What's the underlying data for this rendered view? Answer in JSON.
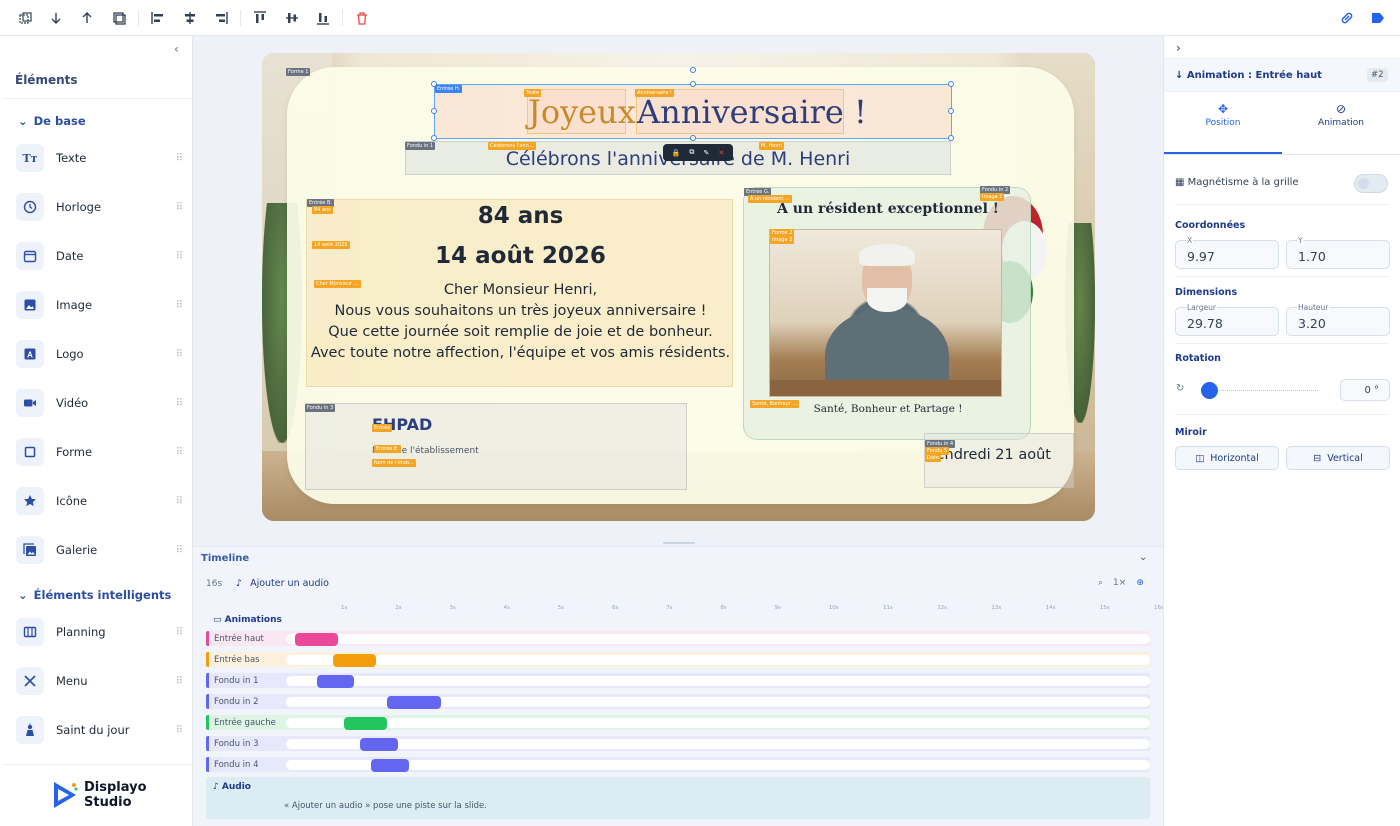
{
  "toolbar": {
    "icons": [
      "duplicate-icon",
      "arrow-down-icon",
      "arrow-up-icon",
      "copy-icon",
      "align-left-icon",
      "align-center-h-icon",
      "align-right-icon",
      "align-top-icon",
      "align-middle-v-icon",
      "align-bottom-icon",
      "delete-icon",
      "link-icon",
      "tag-icon"
    ],
    "accent": "#2563eb"
  },
  "sidebar": {
    "title": "Éléments",
    "section_basic": "De base",
    "basic_items": [
      {
        "label": "Texte",
        "icon": "text-icon"
      },
      {
        "label": "Horloge",
        "icon": "clock-icon"
      },
      {
        "label": "Date",
        "icon": "calendar-icon"
      },
      {
        "label": "Image",
        "icon": "image-icon"
      },
      {
        "label": "Logo",
        "icon": "logo-icon"
      },
      {
        "label": "Vidéo",
        "icon": "video-icon"
      },
      {
        "label": "Forme",
        "icon": "shape-icon"
      },
      {
        "label": "Icône",
        "icon": "star-icon"
      },
      {
        "label": "Galerie",
        "icon": "gallery-icon"
      }
    ],
    "section_smart": "Éléments intelligents",
    "smart_items": [
      {
        "label": "Planning",
        "icon": "planning-icon"
      },
      {
        "label": "Menu",
        "icon": "menu-icon"
      },
      {
        "label": "Saint du jour",
        "icon": "saint-icon"
      }
    ],
    "brand_line1": "Displayo",
    "brand_line2": "Studio"
  },
  "canvas": {
    "title_word1": "Joyeux",
    "title_word2": "Anniversaire !",
    "subtitle": "Célébrons l'anniversaire de M. Henri",
    "age": "84 ans",
    "birth_date": "14 août 2026",
    "message": "Cher Monsieur Henri,\nNous vous souhaitons un très joyeux anniversaire !\nQue cette journée soit remplie de joie et de bonheur.\nAvec toute notre affection, l'équipe et vos amis résidents.",
    "resident_title": "À un résident exceptionnel !",
    "resident_caption": "Santé, Bonheur et Partage !",
    "establishment": "EHPAD",
    "establishment_sub": "Nom de l'établissement",
    "date": "vendredi 21 août",
    "tags": {
      "forme1": "Forme 1",
      "entree_h": "Entrée H.",
      "texte": "Texte",
      "anniversaire": "Anniversaire !",
      "fondu1": "Fondu in 1",
      "celebrons": "Célébrons l'ann...",
      "mhenri": "M. Henri",
      "entree_b": "Entrée B.",
      "ans84": "84 ans",
      "aout": "14 août 2026",
      "cher": "Cher Monsieur ...",
      "entree_g": "Entrée G.",
      "resident": "À un résident ...",
      "fondu2": "Fondu in 2",
      "image1": "Image 1",
      "forme2": "Forme 2",
      "image2": "Image 2",
      "sante": "Santé, Bonheur ...",
      "fondu3": "Fondu in 3",
      "entree": "Entrée",
      "ehpad": "Entrée E.",
      "nometab": "Nom de l'étab...",
      "fondu4": "Fondu in 4",
      "fondu5": "Fondu 5",
      "date": "Date"
    }
  },
  "timeline": {
    "title": "Timeline",
    "duration": "16s",
    "add_audio": "Ajouter un audio",
    "zoom": "1×",
    "animations_label": "Animations",
    "ticks": [
      "1s",
      "2s",
      "3s",
      "4s",
      "5s",
      "6s",
      "7s",
      "8s",
      "9s",
      "10s",
      "11s",
      "12s",
      "13s",
      "14s",
      "15s",
      "16s"
    ],
    "tracks": [
      {
        "name": "Entrée haut",
        "color": "#ec4899",
        "start": 0.2,
        "end": 1.0,
        "bg": "#fbe7f1"
      },
      {
        "name": "Entrée bas",
        "color": "#f59e0b",
        "start": 0.9,
        "end": 1.7,
        "bg": "#fdf0dc"
      },
      {
        "name": "Fondu in 1",
        "color": "#6366f1",
        "start": 0.6,
        "end": 1.3,
        "bg": "#e7e8fb"
      },
      {
        "name": "Fondu in 2",
        "color": "#6366f1",
        "start": 1.9,
        "end": 2.9,
        "bg": "#e7e8fb"
      },
      {
        "name": "Entrée gauche",
        "color": "#22c55e",
        "start": 1.1,
        "end": 1.9,
        "bg": "#def5e6"
      },
      {
        "name": "Fondu in 3",
        "color": "#6366f1",
        "start": 1.4,
        "end": 2.1,
        "bg": "#e7e8fb"
      },
      {
        "name": "Fondu in 4",
        "color": "#6366f1",
        "start": 1.6,
        "end": 2.3,
        "bg": "#e7e8fb"
      }
    ],
    "audio_label": "Audio",
    "audio_hint": "« Ajouter un audio » pose une piste sur la slide."
  },
  "panel": {
    "header": "Animation : Entrée haut",
    "badge": "#2",
    "tab_position": "Position",
    "tab_animation": "Animation",
    "grid_snap": "Magnétisme à la grille",
    "coords_label": "Coordonnées",
    "x_label": "X",
    "x_value": "9.97",
    "y_label": "Y",
    "y_value": "1.70",
    "dims_label": "Dimensions",
    "w_label": "Largeur",
    "w_value": "29.78",
    "h_label": "Hauteur",
    "h_value": "3.20",
    "rotation_label": "Rotation",
    "rotation_value": "0 °",
    "mirror_label": "Miroir",
    "mirror_h": "Horizontal",
    "mirror_v": "Vertical"
  }
}
